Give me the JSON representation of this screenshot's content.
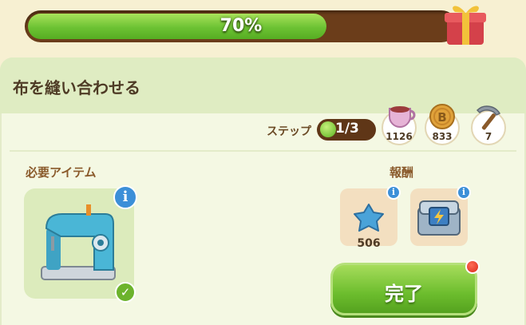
{
  "progress": {
    "percent_label": "70%",
    "value": 0.7
  },
  "quest": {
    "title": "布を縫い合わせる"
  },
  "step": {
    "label": "ステップ",
    "value": "1/3"
  },
  "costs": [
    {
      "icon": "teacup-icon",
      "value": "1126"
    },
    {
      "icon": "coin-icon",
      "value": "833"
    },
    {
      "icon": "pickaxe-icon",
      "value": "7"
    }
  ],
  "required": {
    "label": "必要アイテム",
    "item_icon": "sewing-machine-icon"
  },
  "rewards": {
    "label": "報酬",
    "items": [
      {
        "icon": "blue-gem-icon",
        "value": "506"
      },
      {
        "icon": "energy-chest-icon",
        "value": ""
      }
    ]
  },
  "complete_button": {
    "label": "完了"
  },
  "colors": {
    "progress_green": "#6cc233",
    "track_brown": "#6b3d1a",
    "info_blue": "#3c8fd8"
  }
}
